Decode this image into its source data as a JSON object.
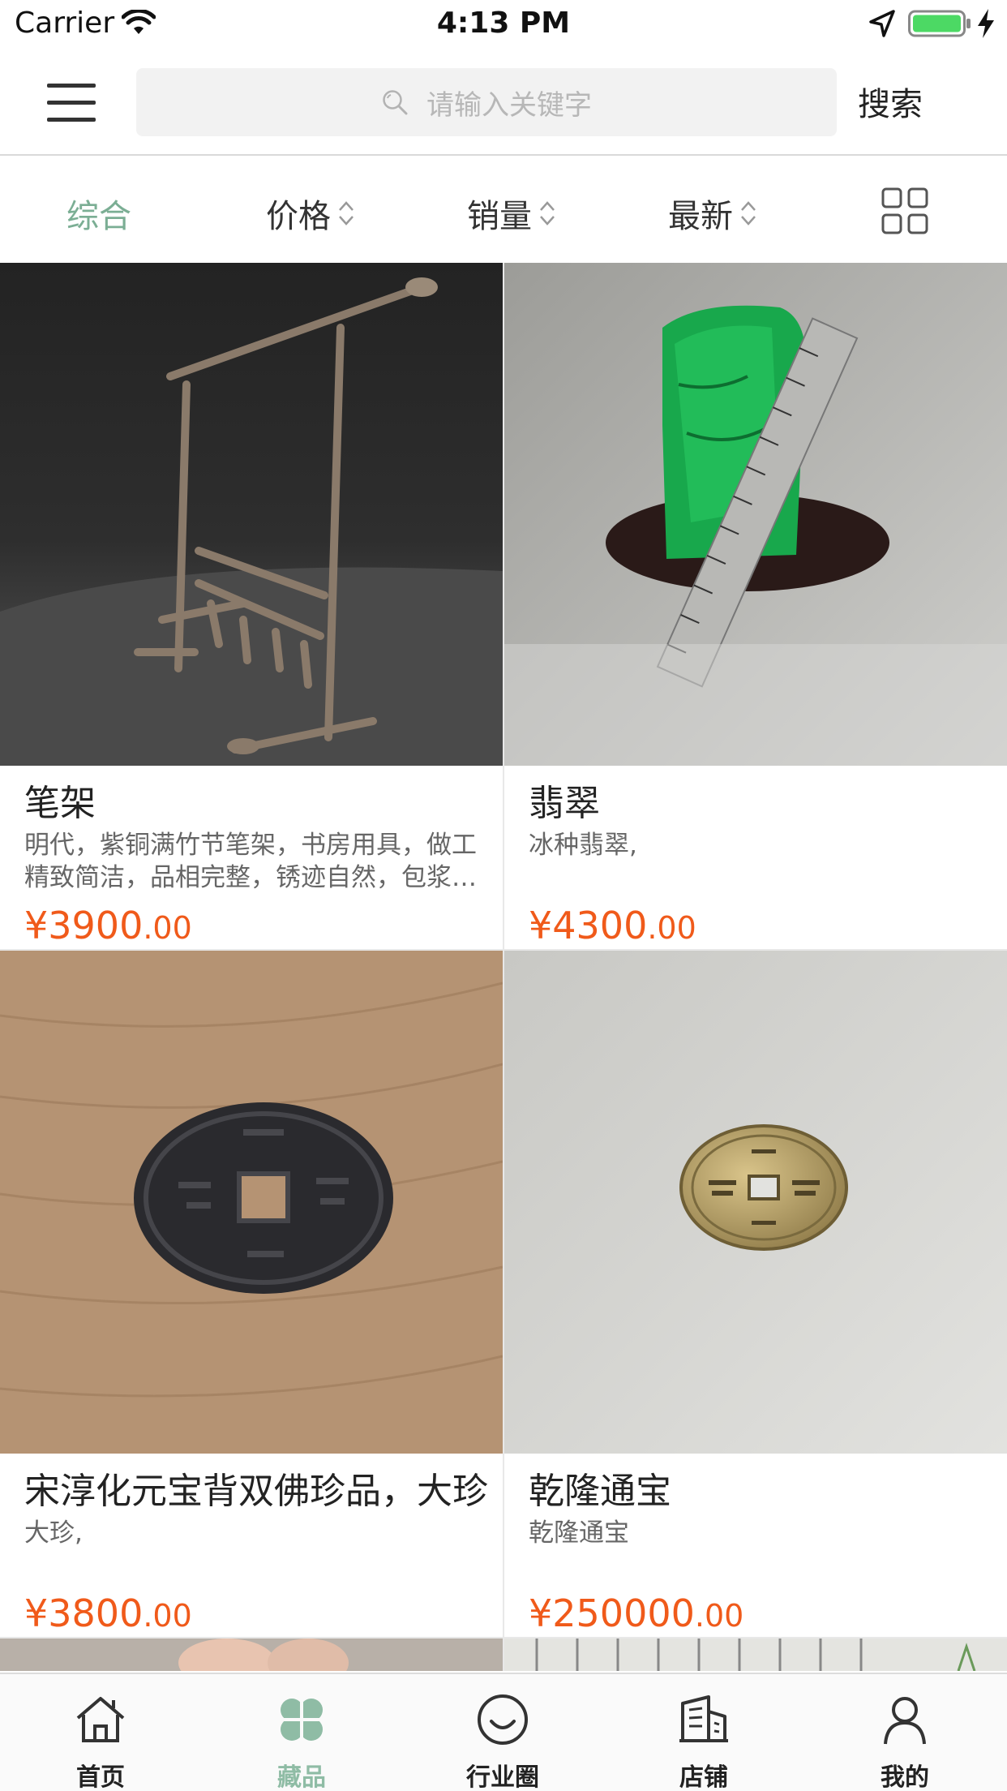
{
  "status_bar": {
    "carrier": "Carrier",
    "time": "4:13 PM"
  },
  "search": {
    "placeholder": "请输入关键字",
    "button_label": "搜索"
  },
  "sort_bar": {
    "items": [
      {
        "label": "综合",
        "active": true
      },
      {
        "label": "价格"
      },
      {
        "label": "销量"
      },
      {
        "label": "最新"
      }
    ],
    "active_color": "#7bae94"
  },
  "products": [
    {
      "title": "笔架",
      "desc": "明代，紫铜满竹节笔架，书房用具，做工精致简洁，品相完整，锈迹自然，包浆厚实",
      "price_main": "¥3900",
      "price_decimal": ".00",
      "image": "bronze-bamboo-brush-rack"
    },
    {
      "title": "翡翠",
      "desc": "冰种翡翠,",
      "price_main": "¥4300",
      "price_decimal": ".00",
      "image": "green-jade-with-ruler"
    },
    {
      "title": "宋淳化元宝背双佛珍品，大珍",
      "desc": "大珍,",
      "price_main": "¥3800",
      "price_decimal": ".00",
      "image": "dark-ancient-coin-on-wood"
    },
    {
      "title": "乾隆通宝",
      "desc": "乾隆通宝",
      "price_main": "¥250000",
      "price_decimal": ".00",
      "image": "brass-qianlong-coin"
    }
  ],
  "colors": {
    "price": "#f05a1a",
    "tab_active": "#8fbca5"
  },
  "tab_bar": {
    "items": [
      {
        "label": "首页",
        "icon": "home-icon"
      },
      {
        "label": "藏品",
        "icon": "clover-icon",
        "active": true
      },
      {
        "label": "行业圈",
        "icon": "smile-circle-icon"
      },
      {
        "label": "店铺",
        "icon": "building-icon"
      },
      {
        "label": "我的",
        "icon": "person-icon"
      }
    ]
  }
}
